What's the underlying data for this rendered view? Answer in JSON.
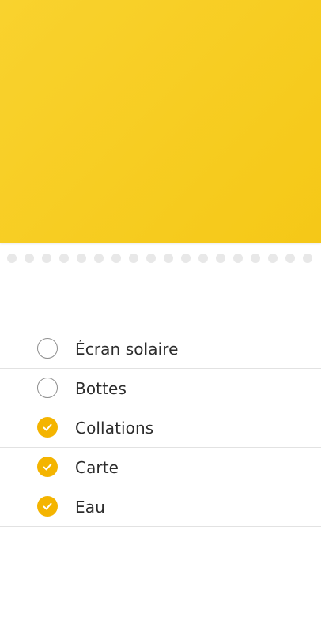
{
  "theme": {
    "banner_gradient_start": "#f9d22e",
    "banner_gradient_end": "#f5c817",
    "accent": "#f4b400",
    "checkmark": "#ffffff"
  },
  "dots": {
    "count": 18
  },
  "checklist": {
    "items": [
      {
        "label": "Écran solaire",
        "checked": false
      },
      {
        "label": "Bottes",
        "checked": false
      },
      {
        "label": "Collations",
        "checked": true
      },
      {
        "label": "Carte",
        "checked": true
      },
      {
        "label": "Eau",
        "checked": true
      }
    ]
  }
}
